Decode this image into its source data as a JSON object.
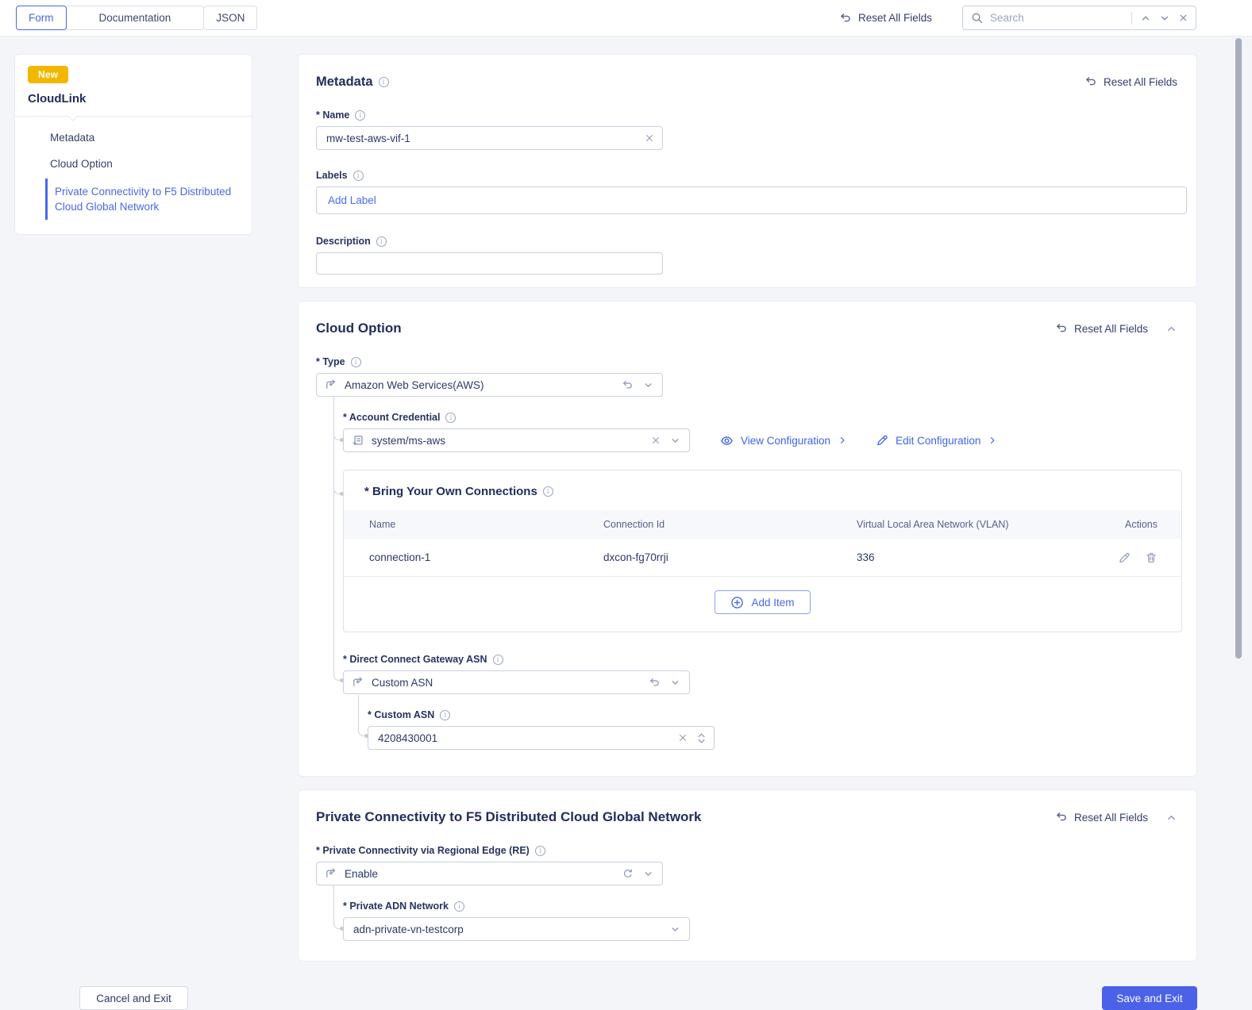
{
  "topbar": {
    "tabs": [
      {
        "label": "Form",
        "active": true
      },
      {
        "label": "Documentation",
        "active": false
      },
      {
        "label": "JSON",
        "active": false
      }
    ],
    "reset_all_label": "Reset All Fields",
    "search": {
      "placeholder": "Search"
    }
  },
  "sidebar": {
    "badge": "New",
    "title": "CloudLink",
    "items": [
      {
        "label": "Metadata",
        "active": false
      },
      {
        "label": "Cloud Option",
        "active": false
      },
      {
        "label": "Private Connectivity to F5 Distributed Cloud Global Network",
        "active": true
      }
    ]
  },
  "sections": {
    "metadata": {
      "title": "Metadata",
      "reset_label": "Reset All Fields",
      "name_label": "* Name",
      "name_value": "mw-test-aws-vif-1",
      "labels_label": "Labels",
      "labels_placeholder": "Add Label",
      "description_label": "Description",
      "description_value": ""
    },
    "cloud_option": {
      "title": "Cloud Option",
      "reset_label": "Reset All Fields",
      "type_label": "* Type",
      "type_value": "Amazon Web Services(AWS)",
      "account_credential_label": "* Account Credential",
      "account_credential_value": "system/ms-aws",
      "view_configuration_label": "View Configuration",
      "edit_configuration_label": "Edit Configuration",
      "byoc": {
        "title": "* Bring Your Own Connections",
        "columns": [
          "Name",
          "Connection Id",
          "Virtual Local Area Network (VLAN)",
          "Actions"
        ],
        "rows": [
          {
            "name": "connection-1",
            "connection_id": "dxcon-fg70rrji",
            "vlan": "336"
          }
        ],
        "add_item_label": "Add Item"
      },
      "dcg_asn_label": "* Direct Connect Gateway ASN",
      "dcg_asn_value": "Custom ASN",
      "custom_asn_label": "* Custom ASN",
      "custom_asn_value": "4208430001"
    },
    "private_connectivity": {
      "title": "Private Connectivity to F5 Distributed Cloud Global Network",
      "reset_label": "Reset All Fields",
      "re_label": "* Private Connectivity via Regional Edge (RE)",
      "re_value": "Enable",
      "adn_label": "* Private ADN Network",
      "adn_value": "adn-private-vn-testcorp"
    }
  },
  "footer": {
    "cancel_label": "Cancel and Exit",
    "save_label": "Save and Exit"
  },
  "icons": [
    "undo-icon",
    "search-icon",
    "chevron-up-icon",
    "chevron-down-icon",
    "close-icon",
    "info-icon",
    "oneof-select-icon",
    "reference-icon",
    "clear-icon",
    "eye-icon",
    "chevron-right-icon",
    "edit-icon",
    "delete-icon",
    "plus-circle-icon",
    "refresh-icon",
    "stepper-up-icon",
    "stepper-down-icon",
    "collapse-icon"
  ],
  "colors": {
    "accent": "#4a61e8",
    "link": "#3f63e6",
    "badge": "#f3b700",
    "navy": "#26335f",
    "page_bg": "#f3f5f8"
  }
}
